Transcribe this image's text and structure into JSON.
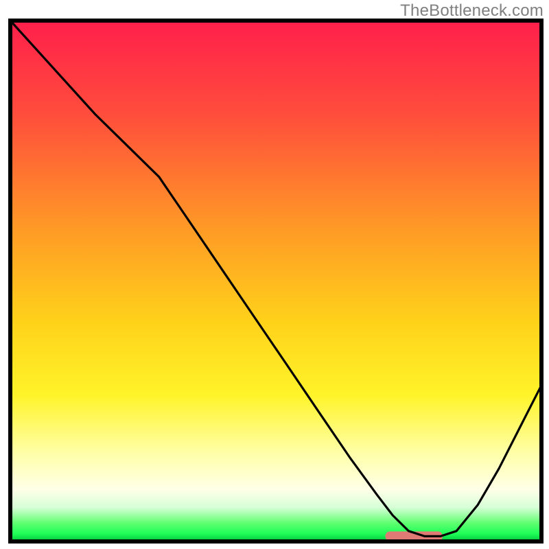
{
  "watermark": "TheBottleneck.com",
  "chart_data": {
    "type": "line",
    "title": "",
    "xlabel": "",
    "ylabel": "",
    "xlim": [
      0,
      100
    ],
    "ylim": [
      0,
      100
    ],
    "gradient_bg": {
      "description": "vertical heat gradient red→orange→yellow→pale→green→dark-green",
      "stops": [
        {
          "offset": 0.0,
          "color": "#ff1f4b"
        },
        {
          "offset": 0.18,
          "color": "#ff4d3c"
        },
        {
          "offset": 0.4,
          "color": "#ff9a26"
        },
        {
          "offset": 0.58,
          "color": "#ffd21a"
        },
        {
          "offset": 0.72,
          "color": "#fff42a"
        },
        {
          "offset": 0.83,
          "color": "#ffffa8"
        },
        {
          "offset": 0.9,
          "color": "#ffffe8"
        },
        {
          "offset": 0.935,
          "color": "#d6ffd6"
        },
        {
          "offset": 0.965,
          "color": "#5eff70"
        },
        {
          "offset": 0.985,
          "color": "#1fff58"
        },
        {
          "offset": 1.0,
          "color": "#00c43a"
        }
      ]
    },
    "series": [
      {
        "name": "curve",
        "color": "#000000",
        "type": "line",
        "x": [
          0,
          8,
          16,
          22,
          28,
          34,
          40,
          46,
          52,
          58,
          64,
          69,
          72,
          75,
          78,
          81,
          84,
          88,
          92,
          96,
          100
        ],
        "y": [
          100,
          91,
          82,
          76,
          70,
          61,
          52,
          43,
          34,
          25,
          16,
          9,
          5,
          2,
          1,
          1,
          2,
          7,
          14,
          22,
          30
        ]
      }
    ],
    "marker": {
      "name": "optimal-range-marker",
      "color": "#e07a74",
      "x_center": 76,
      "y": 1,
      "width": 9,
      "thickness_px": 14,
      "cap": "round"
    },
    "plot_frame": {
      "stroke": "#000000",
      "stroke_width": 6
    }
  }
}
